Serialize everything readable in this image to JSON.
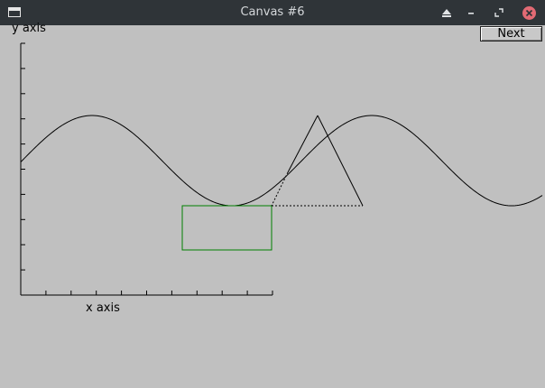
{
  "window": {
    "title": "Canvas #6"
  },
  "toolbar": {
    "next_label": "Next"
  },
  "axes": {
    "ylabel": "y axis",
    "xlabel": "x axis"
  },
  "colors": {
    "background": "#c0c0c0",
    "titlebar": "#2f3438",
    "curve": "#000000",
    "rectangle": "#008000",
    "close_button": "#e26a74"
  },
  "icons": {
    "app": "window-icon",
    "shade": "eject-icon",
    "minimize": "minimize-icon",
    "maximize": "maximize-icon",
    "close": "close-icon"
  }
}
